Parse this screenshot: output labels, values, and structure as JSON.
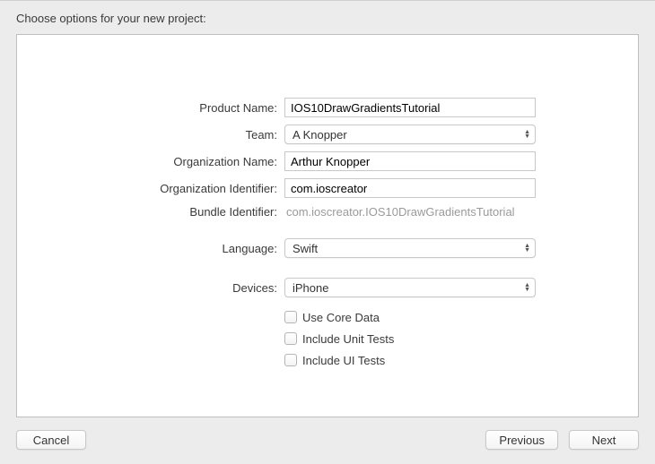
{
  "heading": "Choose options for your new project:",
  "form": {
    "productName": {
      "label": "Product Name:",
      "value": "IOS10DrawGradientsTutorial"
    },
    "team": {
      "label": "Team:",
      "value": "A Knopper"
    },
    "orgName": {
      "label": "Organization Name:",
      "value": "Arthur Knopper"
    },
    "orgId": {
      "label": "Organization Identifier:",
      "value": "com.ioscreator"
    },
    "bundleId": {
      "label": "Bundle Identifier:",
      "value": "com.ioscreator.IOS10DrawGradientsTutorial"
    },
    "language": {
      "label": "Language:",
      "value": "Swift"
    },
    "devices": {
      "label": "Devices:",
      "value": "iPhone"
    },
    "checkboxes": {
      "coreData": "Use Core Data",
      "unitTests": "Include Unit Tests",
      "uiTests": "Include UI Tests"
    }
  },
  "footer": {
    "cancel": "Cancel",
    "previous": "Previous",
    "next": "Next"
  }
}
